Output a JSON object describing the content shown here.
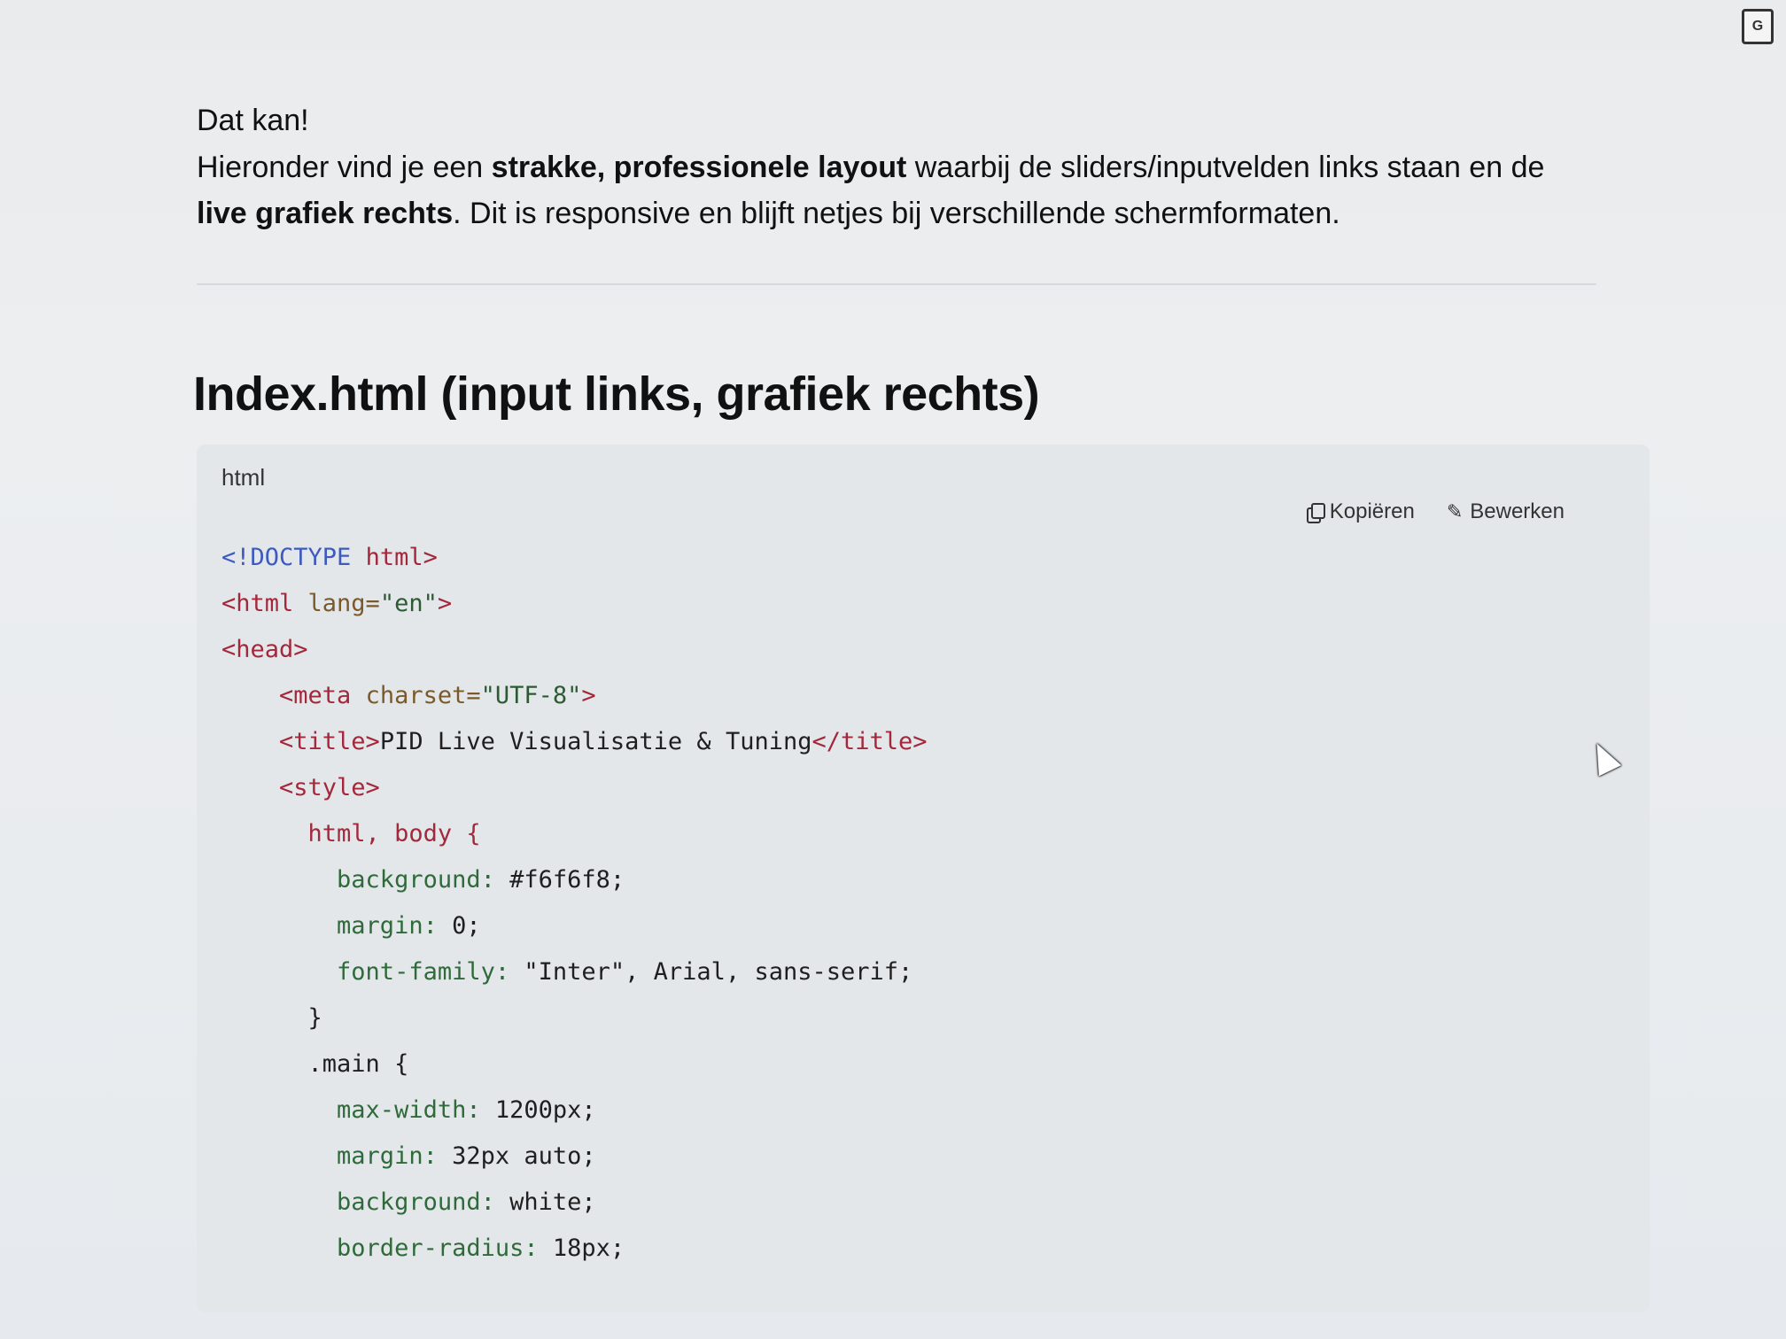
{
  "intro": {
    "line1": "Dat kan!",
    "line2_a": "Hieronder vind je een ",
    "line2_b": "strakke, professionele layout",
    "line2_c": " waarbij de sliders/inputvelden links staan en de ",
    "line2_d": "live grafiek rechts",
    "line2_e": ". Dit is responsive en blijft netjes bij verschillende schermformaten."
  },
  "heading": "Index.html (input links, grafiek rechts)",
  "code": {
    "language": "html",
    "copy_label": "Kopiëren",
    "edit_label": "Bewerken",
    "lines": {
      "l1a": "<!DOCTYPE",
      "l1b": " html>",
      "l2a": "<html",
      "l2b": " lang=",
      "l2c": "\"en\"",
      "l2d": ">",
      "l3": "<head>",
      "l4a": "    <meta",
      "l4b": " charset=",
      "l4c": "\"UTF-8\"",
      "l4d": ">",
      "l5a": "    <title>",
      "l5b": "PID Live Visualisatie & Tuning",
      "l5c": "</title>",
      "l6": "    <style>",
      "l7": "      html, body {",
      "l8a": "        background:",
      "l8b": " #f6f6f8;",
      "l9a": "        margin:",
      "l9b": " 0;",
      "l10a": "        font-family:",
      "l10b": " \"Inter\", Arial, sans-serif;",
      "l11": "      }",
      "l12": "      .main {",
      "l13a": "        max-width:",
      "l13b": " 1200px;",
      "l14a": "        margin:",
      "l14b": " 32px auto;",
      "l15a": "        background:",
      "l15b": " white;",
      "l16a": "        border-radius:",
      "l16b": " 18px;"
    }
  },
  "icons": {
    "translate": "translate-icon",
    "copy": "copy-icon",
    "edit": "pencil-icon",
    "cursor": "mouse-cursor-icon"
  }
}
